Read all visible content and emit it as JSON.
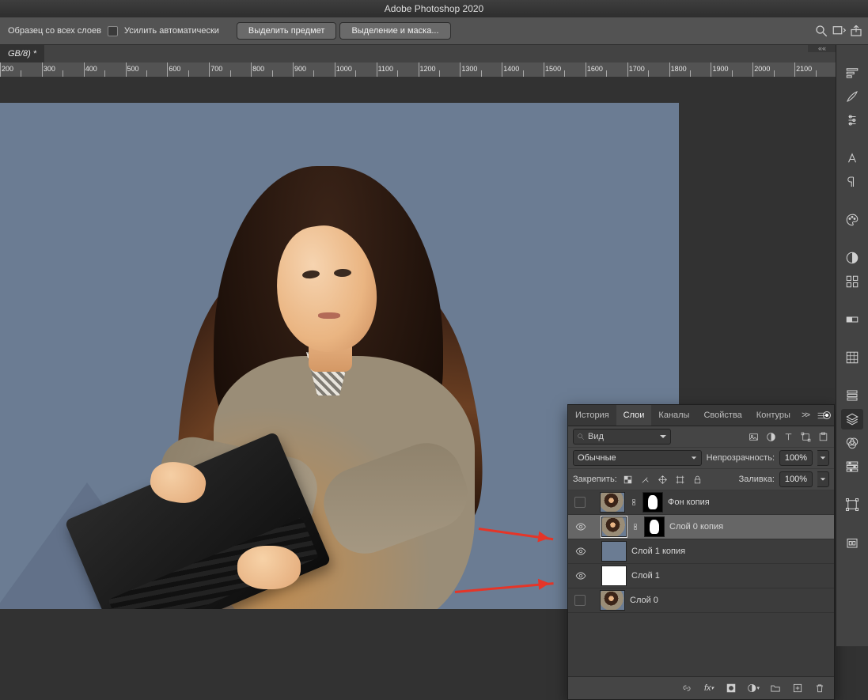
{
  "app": {
    "title": "Adobe Photoshop 2020"
  },
  "optionbar": {
    "sample_label": "Образец со всех слоев",
    "enhance_label": "Усилить автоматически",
    "select_subject": "Выделить предмет",
    "select_and_mask": "Выделение и маска..."
  },
  "doc_tab": "GB/8) *",
  "ruler": {
    "start": 200,
    "end": 2200,
    "step": 50,
    "label_step": 100
  },
  "panel": {
    "tabs": [
      "История",
      "Слои",
      "Каналы",
      "Свойства",
      "Контуры"
    ],
    "active_tab": 1,
    "collapse": ">>",
    "filter": {
      "placeholder": "Вид"
    },
    "blend_mode": "Обычные",
    "opacity_label": "Непрозрачность:",
    "opacity_value": "100%",
    "lock_label": "Закрепить:",
    "fill_label": "Заливка:",
    "fill_value": "100%",
    "layers": [
      {
        "name": "Фон копия",
        "visible": false,
        "selected": false,
        "type": "photo",
        "has_mask": true
      },
      {
        "name": "Слой 0 копия",
        "visible": true,
        "selected": true,
        "type": "photo",
        "has_mask": true
      },
      {
        "name": "Слой 1 копия",
        "visible": true,
        "selected": false,
        "type": "solid_blue",
        "has_mask": false
      },
      {
        "name": "Слой 1",
        "visible": true,
        "selected": false,
        "type": "solid_white",
        "has_mask": false
      },
      {
        "name": "Слой 0",
        "visible": false,
        "selected": false,
        "type": "photo",
        "has_mask": false
      }
    ]
  },
  "dock_icons": [
    "history",
    "brush",
    "settings",
    "character",
    "paragraph",
    "color",
    "adjustments",
    "swatches",
    "screen",
    "pattern",
    "paths",
    "layers",
    "channels",
    "properties",
    "libraries",
    "transform"
  ]
}
